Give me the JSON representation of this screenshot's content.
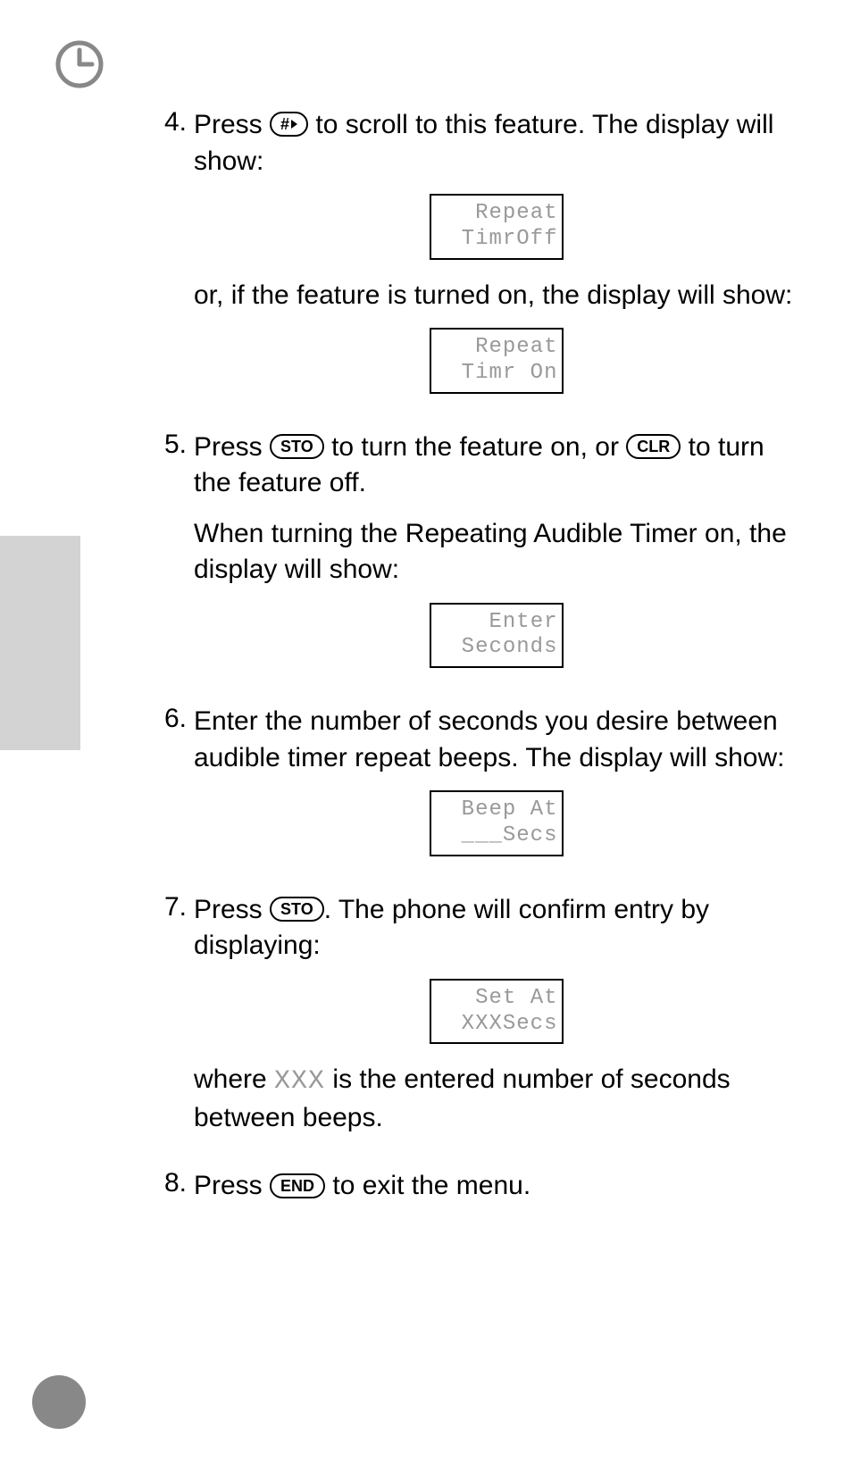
{
  "keys": {
    "hash": "#",
    "sto": "STO",
    "clr": "CLR",
    "end": "END"
  },
  "steps": {
    "s4": {
      "num": "4.",
      "text_a": "Press ",
      "text_b": " to scroll to this feature. The display will show:",
      "display1_l1": "Repeat",
      "display1_l2": "TimrOff",
      "text_c": "or, if the feature is turned on, the display will show:",
      "display2_l1": "Repeat",
      "display2_l2": "Timr On"
    },
    "s5": {
      "num": "5.",
      "text_a": "Press ",
      "text_b": " to turn the feature on, or ",
      "text_c": " to turn the feature off.",
      "text_d": "When turning the Repeating Audible Timer on, the display will show:",
      "display_l1": "Enter",
      "display_l2": "Seconds"
    },
    "s6": {
      "num": "6.",
      "text_a": "Enter the number of seconds you desire between audible timer repeat beeps. The display will show:",
      "display_l1": "Beep At",
      "display_l2": "___Secs"
    },
    "s7": {
      "num": "7.",
      "text_a": "Press ",
      "text_b": ". The phone will confirm entry by displaying:",
      "display_l1": "Set At",
      "display_l2": "XXXSecs",
      "text_c_a": "where ",
      "text_c_mono": "XXX",
      "text_c_b": " is the entered number of seconds between beeps."
    },
    "s8": {
      "num": "8.",
      "text_a": "Press ",
      "text_b": " to exit the menu."
    }
  }
}
